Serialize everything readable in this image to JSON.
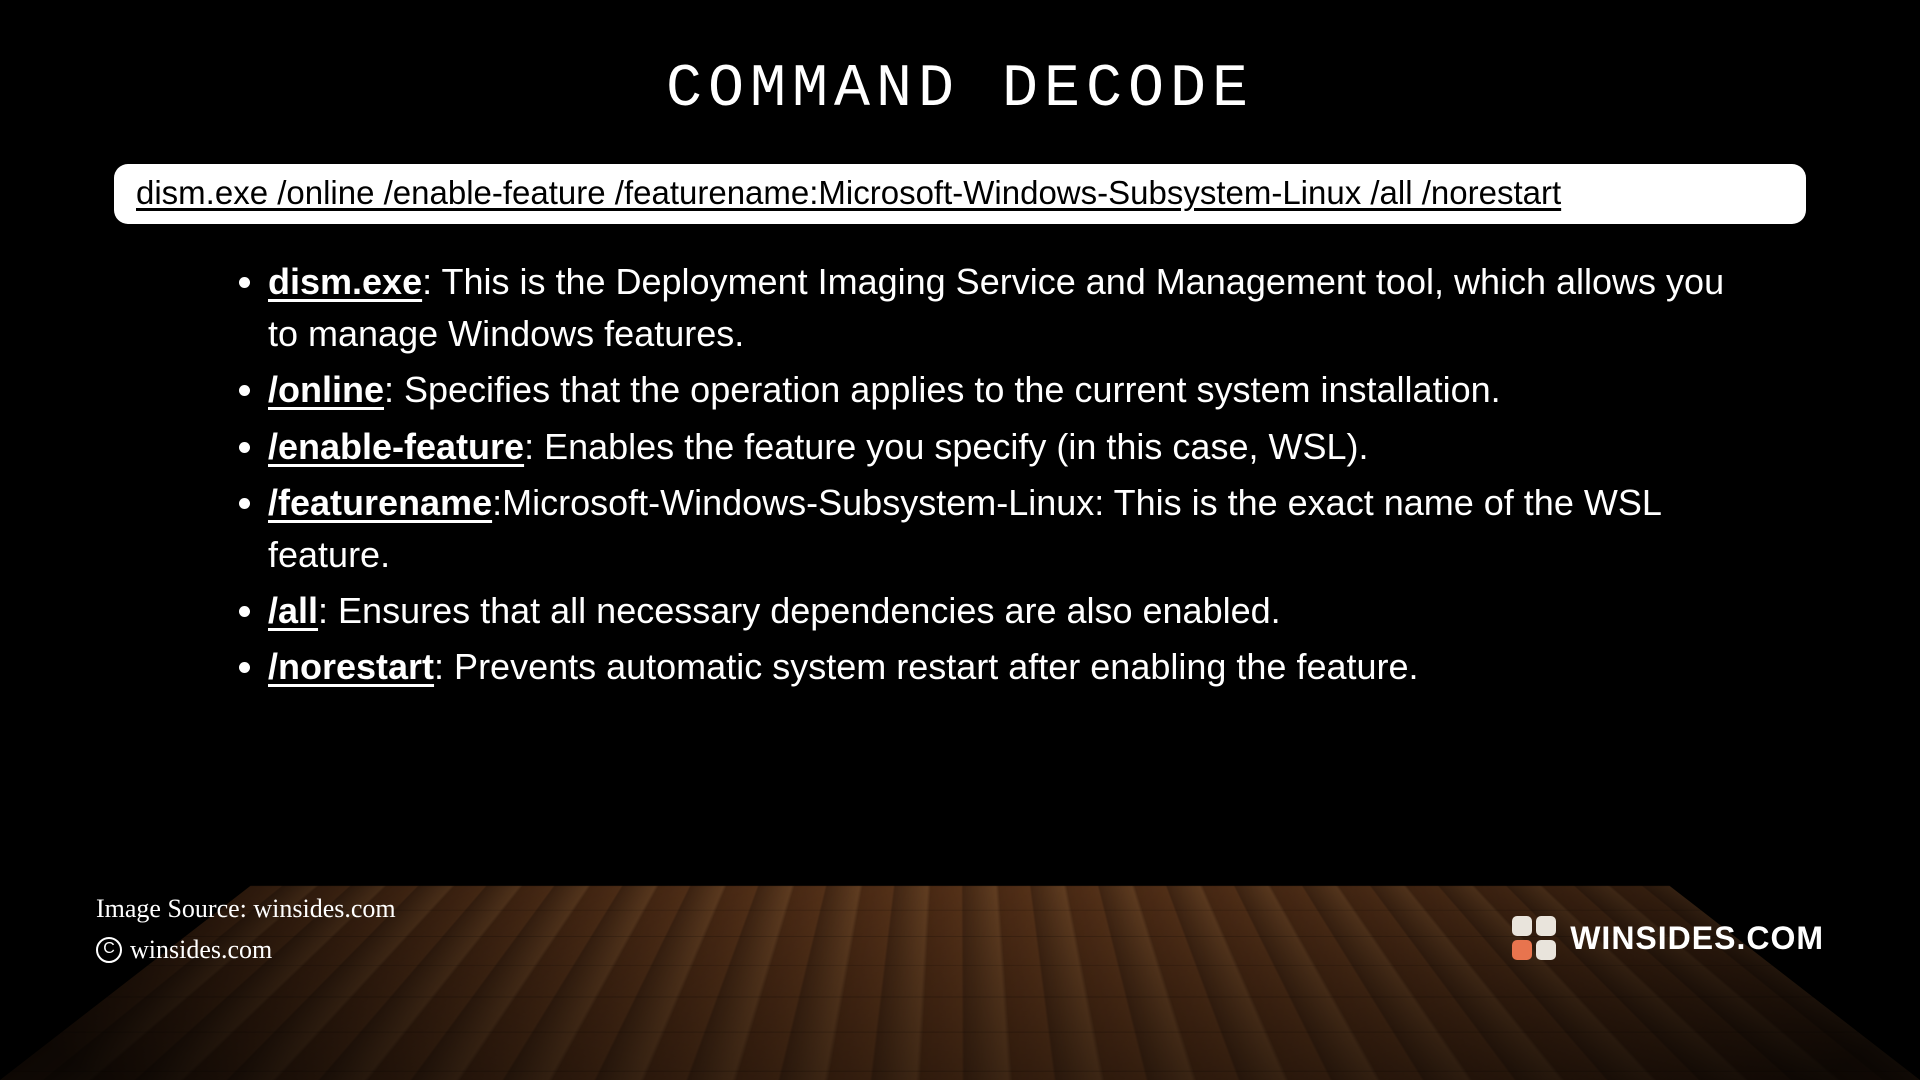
{
  "title": "COMMAND DECODE",
  "command": "dism.exe /online /enable-feature /featurename:Microsoft-Windows-Subsystem-Linux /all /norestart",
  "items": [
    {
      "term": "dism.exe",
      "desc": ": This is the Deployment Imaging Service and Management tool, which allows you to manage Windows features."
    },
    {
      "term": "/online",
      "desc": ": Specifies that the operation applies to the current system installation."
    },
    {
      "term": "/enable-feature",
      "desc": ": Enables the feature you specify (in this case, WSL)."
    },
    {
      "term": "/featurename",
      "desc": ":Microsoft-Windows-Subsystem-Linux: This is the exact name of the WSL feature."
    },
    {
      "term": "/all",
      "desc": ": Ensures that all necessary dependencies are also enabled."
    },
    {
      "term": "/norestart",
      "desc": ": Prevents automatic system restart after enabling the feature."
    }
  ],
  "credits": {
    "source": "Image Source: winsides.com",
    "copyright": "winsides.com"
  },
  "brand": "WINSIDES.COM"
}
